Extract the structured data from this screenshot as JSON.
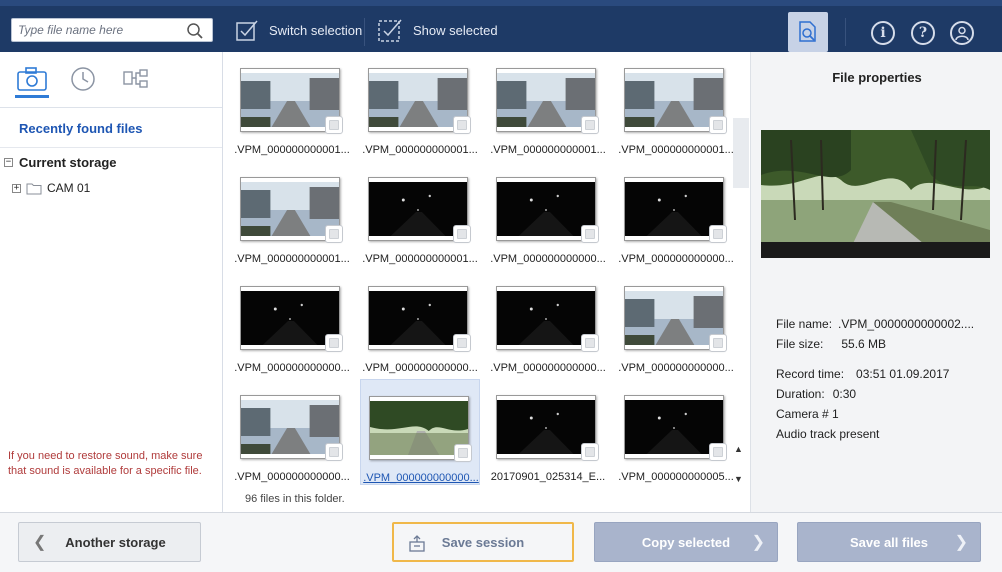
{
  "toolbar": {
    "search_placeholder": "Type file name here",
    "switch_selection": "Switch selection",
    "show_selected": "Show selected",
    "info_glyph": "i",
    "help_glyph": "?"
  },
  "sidebar": {
    "recent_files": "Recently found files",
    "current_storage": "Current storage",
    "storage_item": "CAM 01",
    "hint": "If you need to restore sound, make sure that sound is available for a specific file.",
    "expand_glyph": "+",
    "collapse_glyph": "−"
  },
  "files": [
    {
      "name": ".VPM_000000000001...",
      "scene": "day",
      "selected": false
    },
    {
      "name": ".VPM_000000000001...",
      "scene": "day",
      "selected": false
    },
    {
      "name": ".VPM_000000000001...",
      "scene": "day",
      "selected": false
    },
    {
      "name": ".VPM_000000000001...",
      "scene": "day",
      "selected": false
    },
    {
      "name": ".VPM_000000000001...",
      "scene": "day",
      "selected": false
    },
    {
      "name": ".VPM_000000000001...",
      "scene": "night",
      "selected": false
    },
    {
      "name": ".VPM_000000000000...",
      "scene": "night",
      "selected": false
    },
    {
      "name": ".VPM_000000000000...",
      "scene": "night",
      "selected": false
    },
    {
      "name": ".VPM_000000000000...",
      "scene": "night",
      "selected": false
    },
    {
      "name": ".VPM_000000000000...",
      "scene": "night",
      "selected": false
    },
    {
      "name": ".VPM_000000000000...",
      "scene": "night",
      "selected": false
    },
    {
      "name": ".VPM_000000000000...",
      "scene": "day",
      "selected": false
    },
    {
      "name": ".VPM_000000000000...",
      "scene": "day",
      "selected": false
    },
    {
      "name": ".VPM_000000000000...",
      "scene": "trees",
      "selected": true
    },
    {
      "name": "20170901_025314_E...",
      "scene": "night",
      "selected": false
    },
    {
      "name": ".VPM_000000000005...",
      "scene": "night",
      "selected": false
    }
  ],
  "folder_count": "96 files in this folder.",
  "properties": {
    "title": "File properties",
    "file_name_label": "File name:",
    "file_name": ".VPM_0000000000002....",
    "file_size_label": "File size:",
    "file_size": "55.6 MB",
    "record_time_label": "Record time:",
    "record_time": "03:51 01.09.2017",
    "duration_label": "Duration:",
    "duration": "0:30",
    "camera": "Camera # 1",
    "audio": "Audio track present"
  },
  "buttons": {
    "another_storage": "Another storage",
    "save_session": "Save session",
    "copy_selected": "Copy selected",
    "save_all": "Save all files"
  },
  "colors": {
    "toolbar_bg": "#1e3a66",
    "accent_blue": "#1e56b3",
    "session_outline": "#f0b84a",
    "action_button": "#a9b4cc"
  }
}
